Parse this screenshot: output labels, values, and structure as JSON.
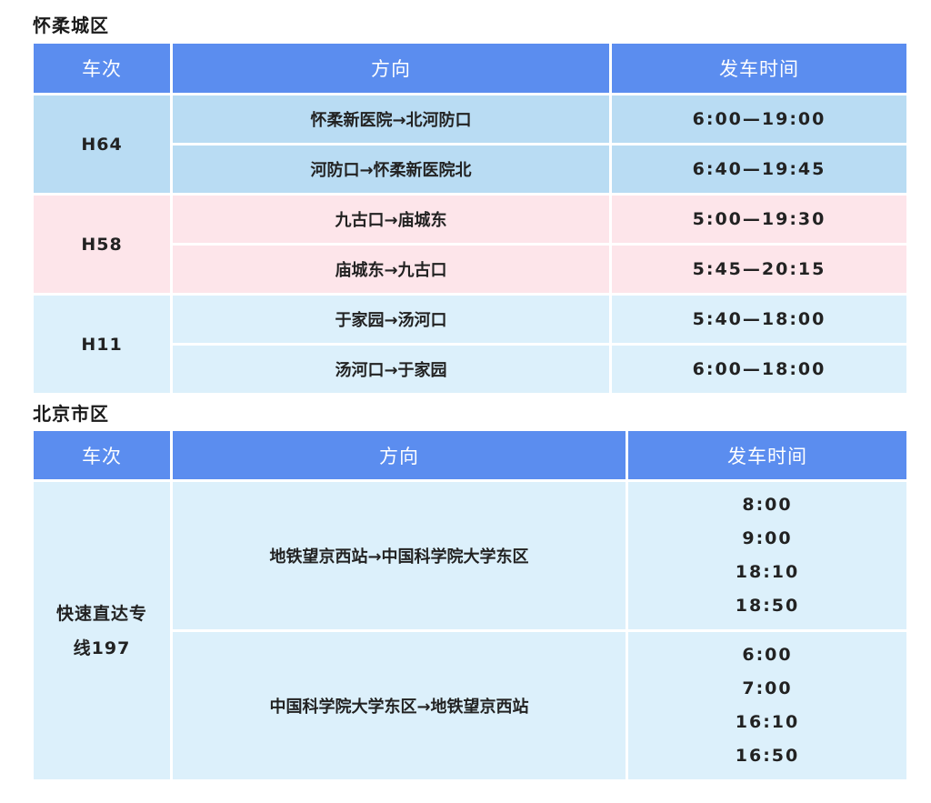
{
  "sections": [
    {
      "title": "怀柔城区",
      "headers": [
        "车次",
        "方向",
        "发车时间"
      ],
      "groups": [
        {
          "code": "H64",
          "rows": [
            {
              "direction": "怀柔新医院→北河防口",
              "time": "6:00—19:00"
            },
            {
              "direction": "河防口→怀柔新医院北",
              "time": "6:40—19:45"
            }
          ]
        },
        {
          "code": "H58",
          "rows": [
            {
              "direction": "九古口→庙城东",
              "time": "5:00—19:30"
            },
            {
              "direction": "庙城东→九古口",
              "time": "5:45—20:15"
            }
          ]
        },
        {
          "code": "H11",
          "rows": [
            {
              "direction": "于家园→汤河口",
              "time": "5:40—18:00"
            },
            {
              "direction": "汤河口→于家园",
              "time": "6:00—18:00"
            }
          ]
        }
      ]
    },
    {
      "title": "北京市区",
      "headers": [
        "车次",
        "方向",
        "发车时间"
      ],
      "groups": [
        {
          "code_line1": "快速直达专",
          "code_line2": "线197",
          "rows": [
            {
              "direction": "地铁望京西站→中国科学院大学东区",
              "times": [
                "8:00",
                "9:00",
                "18:10",
                "18:50"
              ]
            },
            {
              "direction": "中国科学院大学东区→地铁望京西站",
              "times": [
                "6:00",
                "7:00",
                "16:10",
                "16:50"
              ]
            }
          ]
        }
      ]
    }
  ]
}
